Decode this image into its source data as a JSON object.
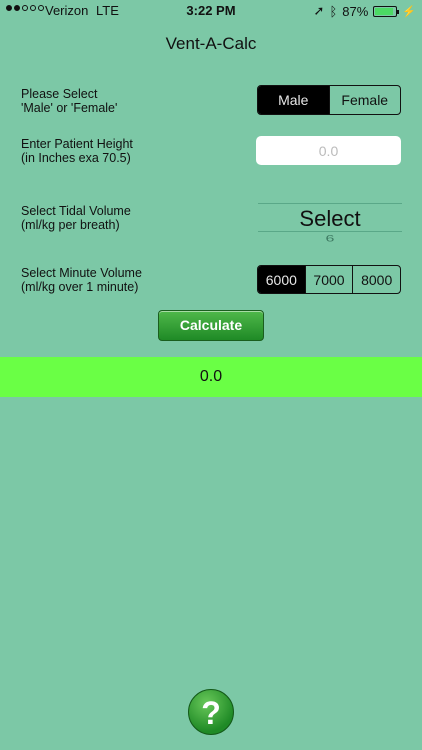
{
  "status_bar": {
    "carrier": "Verizon",
    "network": "LTE",
    "time": "3:22 PM",
    "battery": "87%",
    "battery_level": 0.87,
    "signal_bars_filled": 2,
    "signal_bars_total": 5,
    "icons": [
      "location-arrow-icon",
      "bluetooth-icon",
      "battery-icon",
      "charging-bolt-icon"
    ]
  },
  "app": {
    "title": "Vent-A-Calc"
  },
  "gender": {
    "label_line1": "Please Select",
    "label_line2": "'Male' or 'Female'",
    "options": [
      "Male",
      "Female"
    ],
    "selected": "Male"
  },
  "height": {
    "label_line1": "Enter Patient Height",
    "label_line2": "(in Inches exa 70.5)",
    "placeholder": "0.0"
  },
  "tidal_volume": {
    "label_line1": "Select Tidal Volume",
    "label_line2": "(ml/kg per breath)",
    "selected": "Select",
    "next": "6"
  },
  "minute_volume": {
    "label_line1": "Select Minute Volume",
    "label_line2": "(ml/kg over 1 minute)",
    "options": [
      "6000",
      "7000",
      "8000"
    ],
    "selected": "6000"
  },
  "calculate_label": "Calculate",
  "result": "0.0",
  "help_label": "?",
  "colors": {
    "background": "#7cc8a6",
    "result_bar": "#6aff45",
    "button_green": "#2a9a30"
  }
}
